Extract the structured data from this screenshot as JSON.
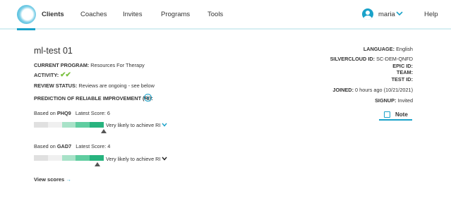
{
  "nav": {
    "items": [
      {
        "label": "Clients",
        "active": true
      },
      {
        "label": "Coaches"
      },
      {
        "label": "Invites"
      },
      {
        "label": "Programs"
      },
      {
        "label": "Tools"
      }
    ],
    "username": "maria",
    "help": "Help",
    "accent_color": "#1aa2c9"
  },
  "client": {
    "title": "ml-test 01",
    "program_label": "CURRENT PROGRAM:",
    "program_value": "Resources For Therapy",
    "activity_label": "ACTIVITY:",
    "activity_value": "✔✔",
    "review_label": "REVIEW STATUS:",
    "review_value": "Reviews are ongoing - see below",
    "prediction_label": "PREDICTION OF RELIABLE IMPROVEMENT (RI):",
    "info_icon": "i"
  },
  "scores": [
    {
      "based_on": "Based on",
      "measure": "PHQ9",
      "latest_label": "Latest Score:",
      "latest_value": "6",
      "likelihood": "Very likely to achieve RI",
      "chevron_color": "#1aa2c9",
      "segment_colors": [
        "#e0e0e0",
        "#f0f0f0",
        "#a8e2c8",
        "#5fcda0",
        "#27b37e"
      ],
      "marker_fraction": 1.0
    },
    {
      "based_on": "Based on",
      "measure": "GAD7",
      "latest_label": "Latest Score:",
      "latest_value": "4",
      "likelihood": "Very likely to achieve RI",
      "chevron_color": "#222222",
      "segment_colors": [
        "#e0e0e0",
        "#f0f0f0",
        "#a8e2c8",
        "#5fcda0",
        "#27b37e"
      ],
      "marker_fraction": 0.9
    }
  ],
  "view_scores": {
    "label": "View scores",
    "arrow": "→"
  },
  "details": {
    "language_label": "LANGUAGE:",
    "language_value": "English",
    "silvercloud_label": "SILVERCLOUD ID:",
    "silvercloud_value": "SC-DEM-QNFD",
    "epic_label": "EPIC ID:",
    "team_label": "TEAM:",
    "test_label": "TEST ID:",
    "joined_label": "JOINED:",
    "joined_value": "0 hours ago (10/21/2021)",
    "signup_label": "SIGNUP:",
    "signup_value": "Invited",
    "note_button": "Note"
  }
}
